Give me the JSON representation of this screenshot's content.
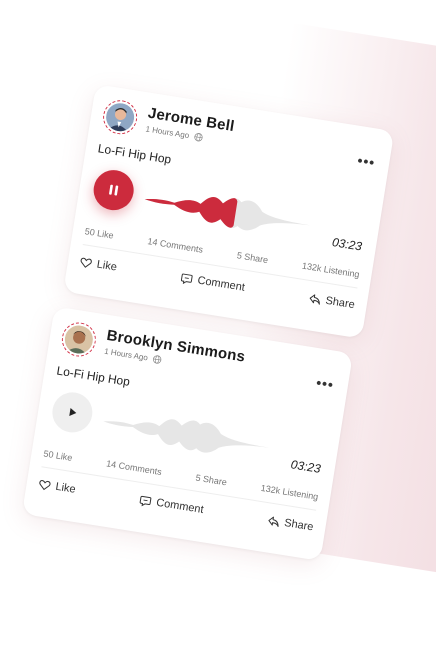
{
  "posts": [
    {
      "author": "Jerome Bell",
      "time_ago": "1 Hours Ago",
      "genre": "Lo-Fi Hip Hop",
      "duration": "03:23",
      "playing": true,
      "progress": 0.55,
      "stats": {
        "likes": "50 Like",
        "comments": "14 Comments",
        "shares": "5 Share",
        "listening": "132k Listening"
      },
      "actions": {
        "like": "Like",
        "comment": "Comment",
        "share": "Share"
      }
    },
    {
      "author": "Brooklyn Simmons",
      "time_ago": "1 Hours Ago",
      "genre": "Lo-Fi Hip Hop",
      "duration": "03:23",
      "playing": false,
      "progress": 0,
      "stats": {
        "likes": "50 Like",
        "comments": "14 Comments",
        "shares": "5 Share",
        "listening": "132k Listening"
      },
      "actions": {
        "like": "Like",
        "comment": "Comment",
        "share": "Share"
      }
    }
  ],
  "icons": {
    "pause": "pause-icon",
    "play": "play-icon",
    "more": "more-icon",
    "globe": "globe-icon",
    "heart": "heart-icon",
    "comment": "comment-icon",
    "share": "share-icon"
  },
  "colors": {
    "accent": "#cc2b3d",
    "wave_inactive": "#e6e6e6",
    "muted": "#777777"
  }
}
